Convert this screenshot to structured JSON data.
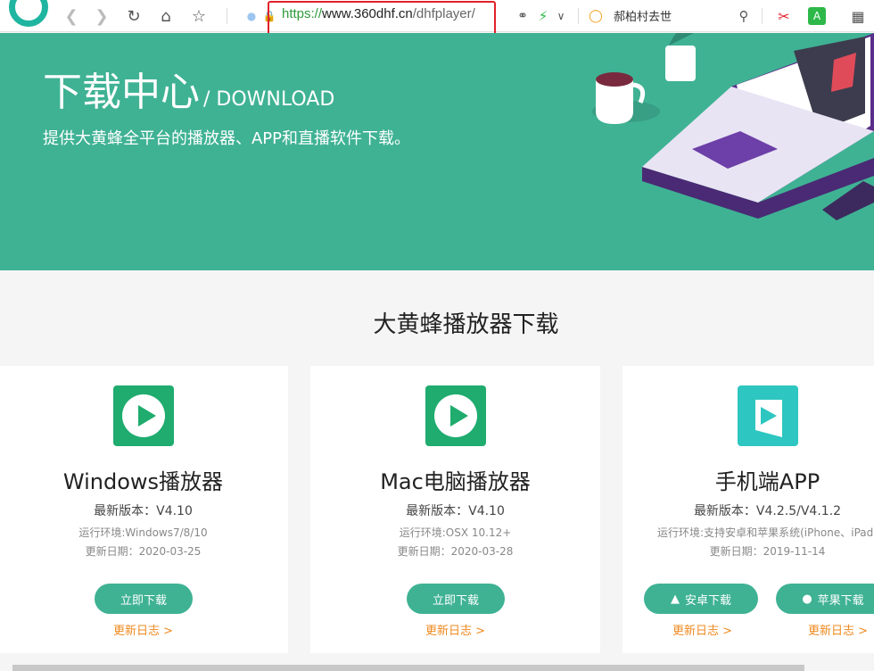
{
  "browser": {
    "url_scheme": "https://",
    "url_domain": "www.360dhf.cn",
    "url_path": "/dhfplayer/",
    "search_text": "郝柏村去世"
  },
  "hero": {
    "title": "下载中心",
    "title_en": "/ DOWNLOAD",
    "subtitle": "提供大黄蜂全平台的播放器、APP和直播软件下载。"
  },
  "section_title": "大黄蜂播放器下载",
  "cards": [
    {
      "name": "Windows播放器",
      "version": "最新版本：V4.10",
      "env": "运行环境:Windows7/8/10",
      "date": "更新日期：2020-03-25",
      "button": "立即下载",
      "log": "更新日志 >"
    },
    {
      "name": "Mac电脑播放器",
      "version": "最新版本：V4.10",
      "env": "运行环境:OSX 10.12+",
      "date": "更新日期：2020-03-28",
      "button": "立即下载",
      "log": "更新日志 >"
    },
    {
      "name": "手机端APP",
      "version": "最新版本：V4.2.5/V4.1.2",
      "env": "运行环境:支持安卓和苹果系统(iPhone、iPad)",
      "date": "更新日期：2019-11-14",
      "button_android": "安卓下载",
      "button_ios": "苹果下载",
      "log_android": "更新日志 >",
      "log_ios": "更新日志 >"
    }
  ],
  "colors": {
    "brand_green": "#3fb294",
    "orange_link": "#f0891f",
    "highlight_red": "#e2202a"
  }
}
